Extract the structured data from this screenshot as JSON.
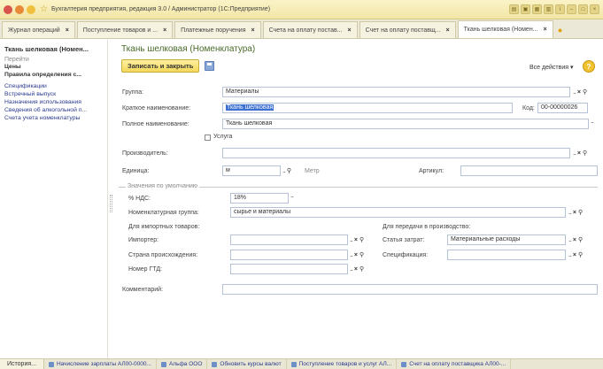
{
  "window": {
    "title": "Бухгалтерия предприятия, редакция 3.0 / Администратор  (1С:Предприятие)"
  },
  "tabs": [
    {
      "label": "Журнал операций",
      "close": "×",
      "active": false
    },
    {
      "label": "Поступление товаров и ...",
      "close": "×",
      "active": false
    },
    {
      "label": "Платежные поручения",
      "close": "×",
      "active": false
    },
    {
      "label": "Счета на оплату постав...",
      "close": "×",
      "active": false
    },
    {
      "label": "Счет на оплату поставщ...",
      "close": "×",
      "active": false
    },
    {
      "label": "Ткань шелковая (Номен...",
      "close": "×",
      "active": true
    }
  ],
  "nav": {
    "form_title": "Ткань шелковая (Номен...",
    "go_header": "Перейти",
    "items_main": [
      "Цены",
      "Правила определения с..."
    ],
    "items_links": [
      "Спецификации",
      "Встречный выпуск",
      "Назначения использования",
      "Сведения об алкогольной п...",
      "Счета учета номенклатуры"
    ]
  },
  "form": {
    "heading": "Ткань шелковая (Номенклатура)",
    "save_close_label": "Записать и закрыть",
    "all_actions_label": "Все действия ▾",
    "help_label": "?",
    "group_label": "Группа:",
    "group_value": "Материалы",
    "short_name_label": "Краткое наименование:",
    "short_name_value": "Ткань шелковая",
    "code_label": "Код:",
    "code_value": "00-00000026",
    "full_name_label": "Полное наименование:",
    "full_name_value": "Ткань шелковая",
    "service_label": "Услуга",
    "manufacturer_label": "Производитель:",
    "manufacturer_value": "",
    "unit_label": "Единица:",
    "unit_value": "м",
    "unit_name": "Метр",
    "article_label": "Артикул:",
    "article_value": "",
    "defaults_group_title": "Значения по умолчанию",
    "vat_label": "% НДС:",
    "vat_value": "18%",
    "nom_group_label": "Номенклатурная группа:",
    "nom_group_value": "сырье и материалы",
    "import_header": "Для импортных товаров:",
    "production_header": "Для передачи в производство:",
    "importer_label": "Импортер:",
    "importer_value": "",
    "cost_item_label": "Статья затрат:",
    "cost_item_value": "Материальные расходы",
    "origin_label": "Страна происхождения:",
    "origin_value": "",
    "spec_label": "Спецификация:",
    "spec_value": "",
    "gtd_label": "Номер ГТД:",
    "gtd_value": "",
    "comment_label": "Комментарий:",
    "comment_value": ""
  },
  "bottombar": {
    "history_label": "История...",
    "tasks": [
      "Начисление зарплаты АЛ00-0000...",
      "Альфа ООО",
      "Обновить курсы валют",
      "Поступление товаров и услуг АЛ...",
      "Счет на оплату поставщика АЛ00-..."
    ]
  },
  "colors": {
    "accent_yellow": "#f3d85a",
    "heading_green": "#4a6b2a",
    "link_blue": "#2a3a8f",
    "selection_blue": "#3b6fd1"
  }
}
